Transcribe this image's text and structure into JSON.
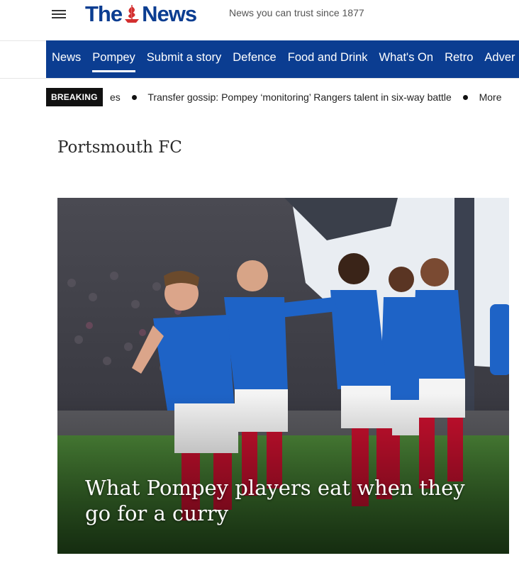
{
  "header": {
    "logo_text_left": "The",
    "logo_text_right": "News",
    "tagline": "News you can trust since 1877",
    "menu_icon": "hamburger-menu-icon",
    "logo_icon": "sailing-ship-icon"
  },
  "nav": {
    "items": [
      {
        "label": "News"
      },
      {
        "label": "Pompey"
      },
      {
        "label": "Submit a story"
      },
      {
        "label": "Defence"
      },
      {
        "label": "Food and Drink"
      },
      {
        "label": "What's On"
      },
      {
        "label": "Retro"
      },
      {
        "label": "Adver"
      }
    ],
    "active": "Pompey"
  },
  "breaking": {
    "badge": "BREAKING",
    "items": [
      "es",
      "Transfer gossip: Pompey ‘monitoring’ Rangers talent in six-way battle",
      "More"
    ]
  },
  "section": {
    "title": "Portsmouth FC"
  },
  "hero": {
    "headline": "What Pompey players eat when they go for a curry",
    "image_alt": "Portsmouth players celebrating a goal in blue kits"
  },
  "colors": {
    "brand_blue": "#0b3d91",
    "logo_red": "#d32f2f",
    "pitch_green": "#3c7a2e",
    "kit_blue": "#1e63c6",
    "sock_red": "#c8102e"
  }
}
